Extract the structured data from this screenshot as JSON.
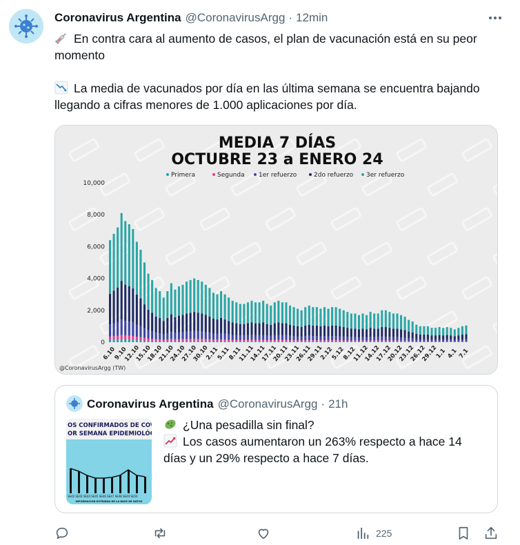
{
  "tweet": {
    "name": "Coronavirus Argentina",
    "handle": "@CoronavirusArgg",
    "separator": "·",
    "time": "12min",
    "line1": "En contra cara al aumento de casos, el plan de vacunación está en su peor momento",
    "line2": "La media de vacunados por día en las última semana se encuentra bajando llegando a cifras menores de 1.000 aplicaciones por día.",
    "icon_line1": "syringe-emoji",
    "icon_line2": "chart-decreasing-emoji"
  },
  "chart_data": {
    "type": "bar",
    "title": "MEDIA 7 DÍAS",
    "subtitle": "OCTUBRE 23 a ENERO 24",
    "credit": "@CoronavirusArgg (TW)",
    "ylim": [
      0,
      10000
    ],
    "yticks": [
      "10,000",
      "8,000",
      "6,000",
      "4,000",
      "2,000",
      "0"
    ],
    "xticks": [
      "6.10",
      "9.10",
      "12.10",
      "15.10",
      "18.10",
      "21.10",
      "24.10",
      "27.10",
      "30.10",
      "2.11",
      "5.11",
      "8.11",
      "11.11",
      "14.11",
      "17.11",
      "20.11",
      "23.11",
      "26.11",
      "29.11",
      "2.12",
      "5.12",
      "8.12",
      "11.12",
      "14.12",
      "17.12",
      "20.12",
      "23.12",
      "26.12",
      "29.12",
      "1.1",
      "4.1",
      "7.1"
    ],
    "legend": [
      "Primera",
      "Segunda",
      "1er refuerzo",
      "2do refuerzo",
      "3er refuerzo"
    ],
    "colors": [
      "#19a3b5",
      "#e8388f",
      "#3b43a6",
      "#1f2a63",
      "#2aa6a6"
    ],
    "totals": [
      6400,
      6800,
      7200,
      8100,
      7600,
      7400,
      7100,
      6300,
      5800,
      5000,
      4300,
      3900,
      3400,
      3200,
      2800,
      3200,
      3700,
      3300,
      3500,
      3600,
      3800,
      3900,
      4000,
      3900,
      3800,
      3600,
      3400,
      3100,
      3000,
      3200,
      3000,
      2800,
      2600,
      2500,
      2400,
      2400,
      2500,
      2600,
      2500,
      2500,
      2600,
      2400,
      2300,
      2500,
      2600,
      2500,
      2500,
      2300,
      2200,
      2100,
      2000,
      2200,
      2300,
      2200,
      2200,
      2100,
      2200,
      2100,
      2200,
      2200,
      2100,
      2000,
      1900,
      1800,
      1800,
      1700,
      1800,
      1700,
      1900,
      1800,
      1800,
      2000,
      2000,
      1900,
      1800,
      1800,
      1700,
      1600,
      1400,
      1300,
      1100,
      1000,
      1000,
      1000,
      900,
      900,
      950,
      900,
      950,
      900,
      800,
      900,
      1000,
      1050
    ]
  },
  "quote": {
    "name": "Coronavirus Argentina",
    "handle": "@CoronavirusArgg",
    "separator": "·",
    "time": "21h",
    "line1": "¿Una pesadilla sin final?",
    "line2": "Los casos aumentaron un 263% respecto a hace 14 días y un 29% respecto a hace 7 días.",
    "thumb_title1": "OS CONFIRMADOS DE COVI",
    "thumb_title2": "OR SEMANA EPIDEMIOLÓGIC",
    "thumb_footer": "INFORMACIÓN EXTRAÍDA DE LA BASE DE DATOS"
  },
  "actions": {
    "views": "225"
  }
}
